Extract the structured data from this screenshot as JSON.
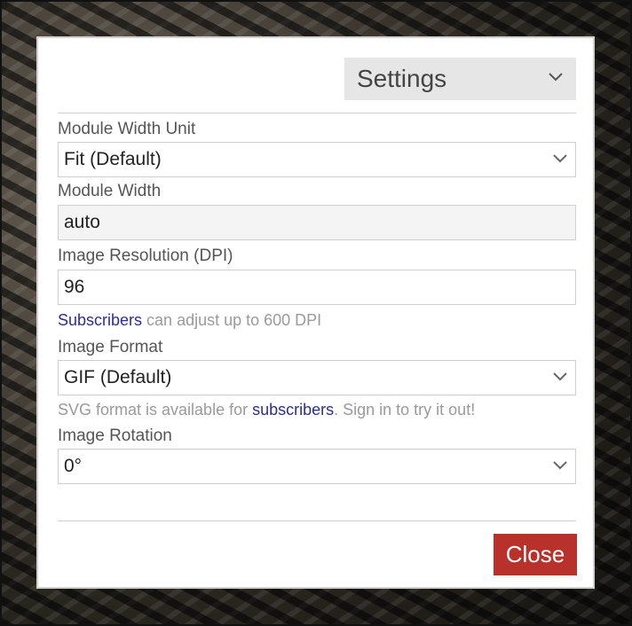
{
  "dialog": {
    "title_dropdown": {
      "label": "Settings",
      "icon": "chevron-down-icon"
    },
    "module_width_unit": {
      "label": "Module Width Unit",
      "value": "Fit (Default)"
    },
    "module_width": {
      "label": "Module Width",
      "value": "auto"
    },
    "image_resolution": {
      "label": "Image Resolution (DPI)",
      "value": "96",
      "hint_link": "Subscribers",
      "hint_text": " can adjust up to 600 DPI"
    },
    "image_format": {
      "label": "Image Format",
      "value": "GIF (Default)",
      "hint_before": "SVG format is available for ",
      "hint_link": "subscribers",
      "hint_after": ". Sign in to try it out!"
    },
    "image_rotation": {
      "label": "Image Rotation",
      "value": "0°"
    },
    "close_label": "Close"
  },
  "colors": {
    "accent_button": "#b8312a",
    "link": "#2b2e8f",
    "hint": "#9a9a9a"
  }
}
